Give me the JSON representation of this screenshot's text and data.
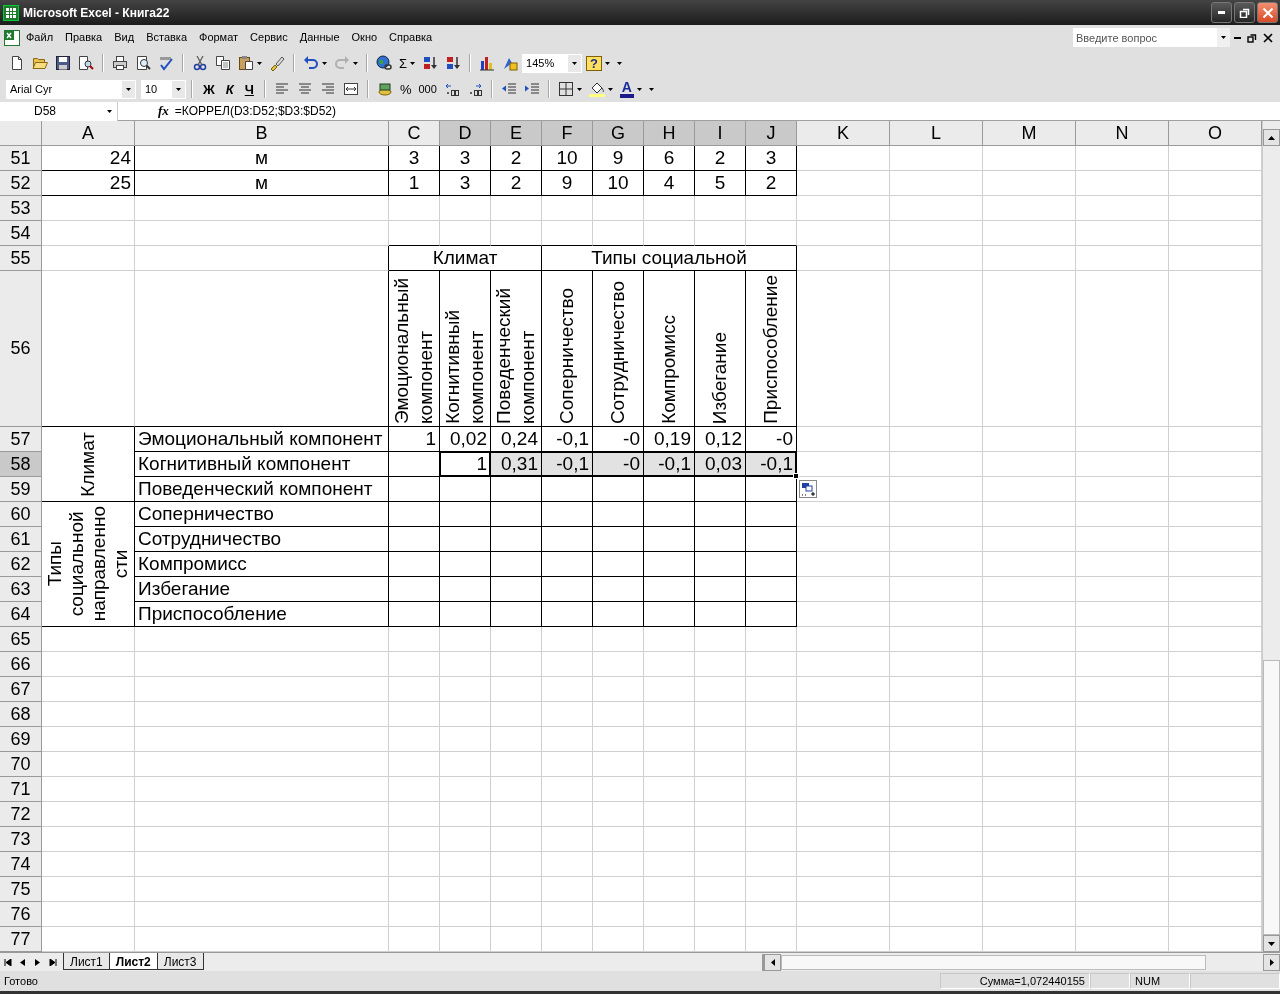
{
  "window": {
    "title": "Microsoft Excel - Книга22"
  },
  "menu": [
    "Файл",
    "Правка",
    "Вид",
    "Вставка",
    "Формат",
    "Сервис",
    "Данные",
    "Окно",
    "Справка"
  ],
  "help_box": {
    "placeholder": "Введите вопрос"
  },
  "standard_toolbar": {
    "sum": "Σ",
    "zoom": "145%",
    "help": "?",
    "redo": {
      "disabled": true
    }
  },
  "formatting_toolbar": {
    "font": "Arial Cyr",
    "size": "10",
    "styles": [
      "Ж",
      "К",
      "Ч"
    ],
    "percent": "%",
    "thousands": "000",
    "font_color": "A"
  },
  "formula_bar": {
    "name_box": "D58",
    "function_label": "fx",
    "formula": "=КОРРЕЛ(D3:D52;$D3:$D52)"
  },
  "sheet": {
    "column_headers": [
      {
        "label": "A",
        "selected": false
      },
      {
        "label": "B",
        "selected": false
      },
      {
        "label": "C",
        "selected": false
      },
      {
        "label": "D",
        "selected": true
      },
      {
        "label": "E",
        "selected": true
      },
      {
        "label": "F",
        "selected": true
      },
      {
        "label": "G",
        "selected": true
      },
      {
        "label": "H",
        "selected": true
      },
      {
        "label": "I",
        "selected": true
      },
      {
        "label": "J",
        "selected": true
      },
      {
        "label": "K",
        "selected": false
      },
      {
        "label": "L",
        "selected": false
      },
      {
        "label": "M",
        "selected": false
      },
      {
        "label": "N",
        "selected": false
      },
      {
        "label": "O",
        "selected": false
      }
    ],
    "row_headers": [
      {
        "label": "51",
        "selected": false
      },
      {
        "label": "52",
        "selected": false
      },
      {
        "label": "53",
        "selected": false
      },
      {
        "label": "54",
        "selected": false
      },
      {
        "label": "55",
        "selected": false
      },
      {
        "label": "56",
        "selected": false
      },
      {
        "label": "57",
        "selected": false
      },
      {
        "label": "58",
        "selected": true
      },
      {
        "label": "59",
        "selected": false
      },
      {
        "label": "60",
        "selected": false
      },
      {
        "label": "61",
        "selected": false
      },
      {
        "label": "62",
        "selected": false
      },
      {
        "label": "63",
        "selected": false
      },
      {
        "label": "64",
        "selected": false
      },
      {
        "label": "65",
        "selected": false
      },
      {
        "label": "66",
        "selected": false
      },
      {
        "label": "67",
        "selected": false
      },
      {
        "label": "68",
        "selected": false
      },
      {
        "label": "69",
        "selected": false
      },
      {
        "label": "70",
        "selected": false
      },
      {
        "label": "71",
        "selected": false
      },
      {
        "label": "72",
        "selected": false
      },
      {
        "label": "73",
        "selected": false
      },
      {
        "label": "74",
        "selected": false
      },
      {
        "label": "75",
        "selected": false
      },
      {
        "label": "76",
        "selected": false
      },
      {
        "label": "77",
        "selected": false
      }
    ],
    "data_rows": [
      {
        "column_a": "24",
        "column_b": "м",
        "values": [
          "3",
          "3",
          "2",
          "10",
          "9",
          "6",
          "2",
          "3"
        ]
      },
      {
        "column_a": "25",
        "column_b": "м",
        "values": [
          "1",
          "3",
          "2",
          "9",
          "10",
          "4",
          "5",
          "2"
        ]
      }
    ],
    "matrix": {
      "group_headers": [
        "Климат",
        "Типы социальной"
      ],
      "column_labels": [
        [
          "Эмоциональный",
          "компонент"
        ],
        [
          "Когнитивный",
          "компонент"
        ],
        [
          "Поведенческий",
          "компонент"
        ],
        [
          "Соперничество"
        ],
        [
          "Сотрудничество"
        ],
        [
          "Компромисс"
        ],
        [
          "Избегание"
        ],
        [
          "Приспособление"
        ]
      ],
      "row_groups": [
        {
          "lines": [
            "Климат"
          ],
          "rows": [
            {
              "label": "Эмоциональный компонент",
              "values": [
                {
                  "text": "1",
                  "selected": false,
                  "active": false
                },
                {
                  "text": "0,02",
                  "selected": false,
                  "active": false
                },
                {
                  "text": "0,24",
                  "selected": false,
                  "active": false
                },
                {
                  "text": "-0,1",
                  "selected": false,
                  "active": false
                },
                {
                  "text": "-0",
                  "selected": false,
                  "active": false
                },
                {
                  "text": "0,19",
                  "selected": false,
                  "active": false
                },
                {
                  "text": "0,12",
                  "selected": false,
                  "active": false
                },
                {
                  "text": "-0",
                  "selected": false,
                  "active": false
                }
              ]
            },
            {
              "label": "Когнитивный компонент",
              "values": [
                {
                  "selected": false,
                  "active": false
                },
                {
                  "text": "1",
                  "selected": true,
                  "active": true
                },
                {
                  "text": "0,31",
                  "selected": true,
                  "active": false
                },
                {
                  "text": "-0,1",
                  "selected": true,
                  "active": false
                },
                {
                  "text": "-0",
                  "selected": true,
                  "active": false
                },
                {
                  "text": "-0,1",
                  "selected": true,
                  "active": false
                },
                {
                  "text": "0,03",
                  "selected": true,
                  "active": false
                },
                {
                  "text": "-0,1",
                  "selected": true,
                  "active": false
                }
              ]
            },
            {
              "label": "Поведенческий компонент"
            }
          ]
        },
        {
          "lines": [
            "Типы",
            "социальной",
            "направленно",
            "сти"
          ],
          "rows": [
            {
              "label": "Соперничество"
            },
            {
              "label": "Сотрудничество"
            },
            {
              "label": "Компромисс"
            },
            {
              "label": "Избегание"
            },
            {
              "label": "Приспособление"
            }
          ]
        }
      ]
    }
  },
  "sheet_tabs": [
    {
      "label": "Лист1",
      "selected": false
    },
    {
      "label": "Лист2",
      "selected": true
    },
    {
      "label": "Лист3",
      "selected": false
    }
  ],
  "status_bar": {
    "state": "Готово",
    "sum": "Сумма=1,072440155",
    "indicator": "NUM"
  }
}
